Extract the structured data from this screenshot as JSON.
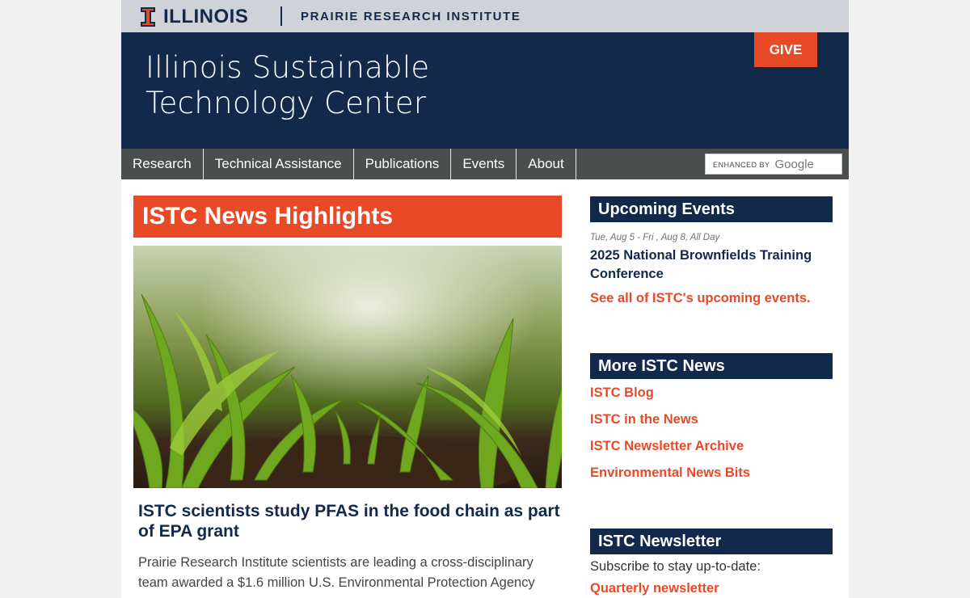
{
  "header": {
    "university": "ILLINOIS",
    "institute": "PRAIRIE RESEARCH INSTITUTE",
    "site_title_line1": "Illinois Sustainable",
    "site_title_line2": "Technology Center",
    "give_label": "GIVE"
  },
  "nav": {
    "items": [
      {
        "label": "Research"
      },
      {
        "label": "Technical Assistance"
      },
      {
        "label": "Publications"
      },
      {
        "label": "Events"
      },
      {
        "label": "About"
      }
    ],
    "search": {
      "enhanced_label": "ENHANCED BY",
      "brand": "Google"
    }
  },
  "main": {
    "heading": "ISTC News Highlights",
    "article": {
      "title": "ISTC scientists study PFAS in the food chain as part of EPA grant",
      "body": "Prairie Research Institute scientists are leading a cross-disciplinary team awarded a $1.6 million U.S. Environmental Protection Agency"
    }
  },
  "sidebar": {
    "events": {
      "heading": "Upcoming Events",
      "date": "Tue, Aug 5 - Fri ,  Aug 8, All Day",
      "title": "2025 National Brownfields Training Conference",
      "see_all": "See all of ISTC′s upcoming events."
    },
    "more_news": {
      "heading": "More ISTC News",
      "links": [
        "ISTC Blog",
        "ISTC in the News",
        "ISTC Newsletter Archive",
        "Environmental News Bits"
      ]
    },
    "newsletter": {
      "heading": "ISTC Newsletter",
      "subscribe_text": "Subscribe to stay up-to-date:",
      "link": "Quarterly newsletter"
    }
  },
  "colors": {
    "illinois_blue": "#13294b",
    "illinois_orange": "#e84a27",
    "nav_gray": "#4a4e4d",
    "topbar_gray": "#cfd2d6"
  },
  "icons": {
    "logo": "block-i-icon"
  }
}
